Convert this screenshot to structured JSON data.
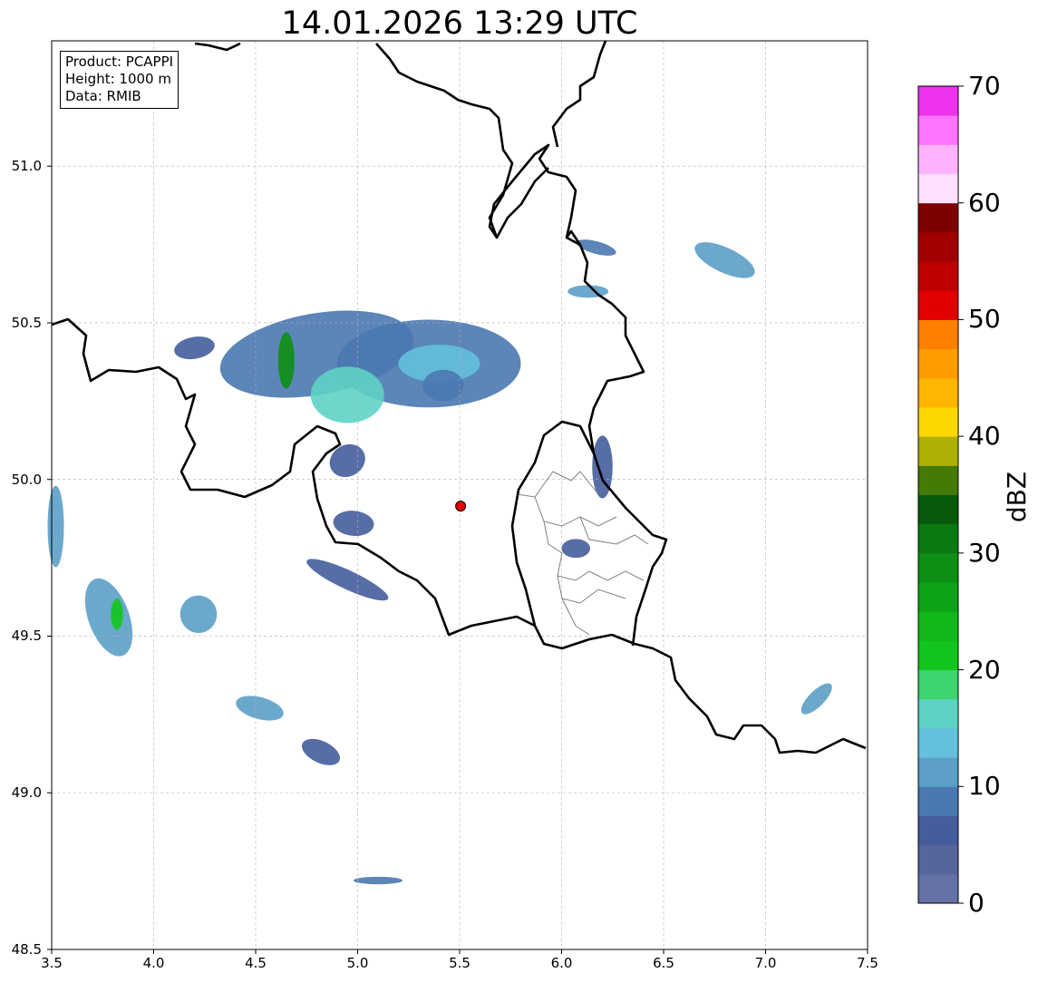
{
  "title": "14.01.2026 13:29 UTC",
  "info_box": {
    "product": "Product: PCAPPI",
    "height": "Height: 1000 m",
    "data": "Data: RMIB"
  },
  "map": {
    "lon_range": [
      3.5,
      7.5
    ],
    "lat_range": [
      48.5,
      51.4
    ],
    "grid": true,
    "x_ticks": [
      "3.5",
      "4.0",
      "4.5",
      "5.0",
      "5.5",
      "6.0",
      "6.5",
      "7.0",
      "7.5"
    ],
    "y_ticks": [
      "48.5",
      "49.0",
      "49.5",
      "50.0",
      "50.5",
      "51.0"
    ],
    "radar_site": {
      "lon": 5.505,
      "lat": 49.915,
      "color": "#e00000"
    },
    "border_color": "#000000",
    "admin_border_color": "#808080"
  },
  "colorbar": {
    "label": "dBZ",
    "range": [
      0,
      70
    ],
    "ticks": [
      "0",
      "10",
      "20",
      "30",
      "40",
      "50",
      "60",
      "70"
    ],
    "colors": [
      "#6472a6",
      "#55669d",
      "#455d9c",
      "#4a78b0",
      "#5b9fc7",
      "#64c0dc",
      "#5ed3c4",
      "#3ed46f",
      "#12c51c",
      "#10b81a",
      "#0ea216",
      "#0d8f13",
      "#0a7a10",
      "#075a0b",
      "#447a05",
      "#afb004",
      "#ffd700",
      "#ffb600",
      "#ff9d00",
      "#ff7f00",
      "#e00000",
      "#c00000",
      "#a00000",
      "#7c0000",
      "#ffe0ff",
      "#ffb3ff",
      "#ff74ff",
      "#ee32ee"
    ]
  },
  "echoes": [
    {
      "lon": 4.8,
      "lat": 50.4,
      "rx": 0.48,
      "ry": 0.13,
      "rot": -10,
      "dbz": 8
    },
    {
      "lon": 5.35,
      "lat": 50.37,
      "rx": 0.45,
      "ry": 0.14,
      "rot": 0,
      "dbz": 8
    },
    {
      "lon": 4.95,
      "lat": 50.27,
      "rx": 0.18,
      "ry": 0.09,
      "rot": 0,
      "dbz": 15
    },
    {
      "lon": 5.4,
      "lat": 50.37,
      "rx": 0.2,
      "ry": 0.06,
      "rot": 0,
      "dbz": 14
    },
    {
      "lon": 4.65,
      "lat": 50.38,
      "rx": 0.04,
      "ry": 0.09,
      "rot": 0,
      "dbz": 28
    },
    {
      "lon": 4.2,
      "lat": 50.42,
      "rx": 0.1,
      "ry": 0.035,
      "rot": -10,
      "dbz": 7
    },
    {
      "lon": 4.95,
      "lat": 50.06,
      "rx": 0.09,
      "ry": 0.05,
      "rot": -30,
      "dbz": 7
    },
    {
      "lon": 4.98,
      "lat": 49.86,
      "rx": 0.1,
      "ry": 0.04,
      "rot": 5,
      "dbz": 7
    },
    {
      "lon": 5.42,
      "lat": 50.3,
      "rx": 0.1,
      "ry": 0.05,
      "rot": 0,
      "dbz": 9
    },
    {
      "lon": 4.95,
      "lat": 49.68,
      "rx": 0.22,
      "ry": 0.03,
      "rot": 25,
      "dbz": 7
    },
    {
      "lon": 3.52,
      "lat": 49.85,
      "rx": 0.04,
      "ry": 0.13,
      "rot": 0,
      "dbz": 10
    },
    {
      "lon": 3.78,
      "lat": 49.56,
      "rx": 0.1,
      "ry": 0.13,
      "rot": -20,
      "dbz": 12
    },
    {
      "lon": 3.82,
      "lat": 49.57,
      "rx": 0.03,
      "ry": 0.05,
      "rot": 0,
      "dbz": 22
    },
    {
      "lon": 4.22,
      "lat": 49.57,
      "rx": 0.09,
      "ry": 0.06,
      "rot": -10,
      "dbz": 10
    },
    {
      "lon": 4.52,
      "lat": 49.27,
      "rx": 0.12,
      "ry": 0.035,
      "rot": 15,
      "dbz": 11
    },
    {
      "lon": 4.82,
      "lat": 49.13,
      "rx": 0.1,
      "ry": 0.035,
      "rot": 25,
      "dbz": 7
    },
    {
      "lon": 5.1,
      "lat": 48.72,
      "rx": 0.12,
      "ry": 0.012,
      "rot": 0,
      "dbz": 8
    },
    {
      "lon": 6.07,
      "lat": 49.78,
      "rx": 0.07,
      "ry": 0.03,
      "rot": 0,
      "dbz": 7
    },
    {
      "lon": 6.2,
      "lat": 50.04,
      "rx": 0.05,
      "ry": 0.1,
      "rot": 0,
      "dbz": 7
    },
    {
      "lon": 6.13,
      "lat": 50.6,
      "rx": 0.1,
      "ry": 0.02,
      "rot": 0,
      "dbz": 10
    },
    {
      "lon": 6.17,
      "lat": 50.74,
      "rx": 0.1,
      "ry": 0.02,
      "rot": 15,
      "dbz": 9
    },
    {
      "lon": 6.8,
      "lat": 50.7,
      "rx": 0.16,
      "ry": 0.04,
      "rot": 25,
      "dbz": 10
    },
    {
      "lon": 7.25,
      "lat": 49.3,
      "rx": 0.1,
      "ry": 0.025,
      "rot": -45,
      "dbz": 12
    }
  ]
}
